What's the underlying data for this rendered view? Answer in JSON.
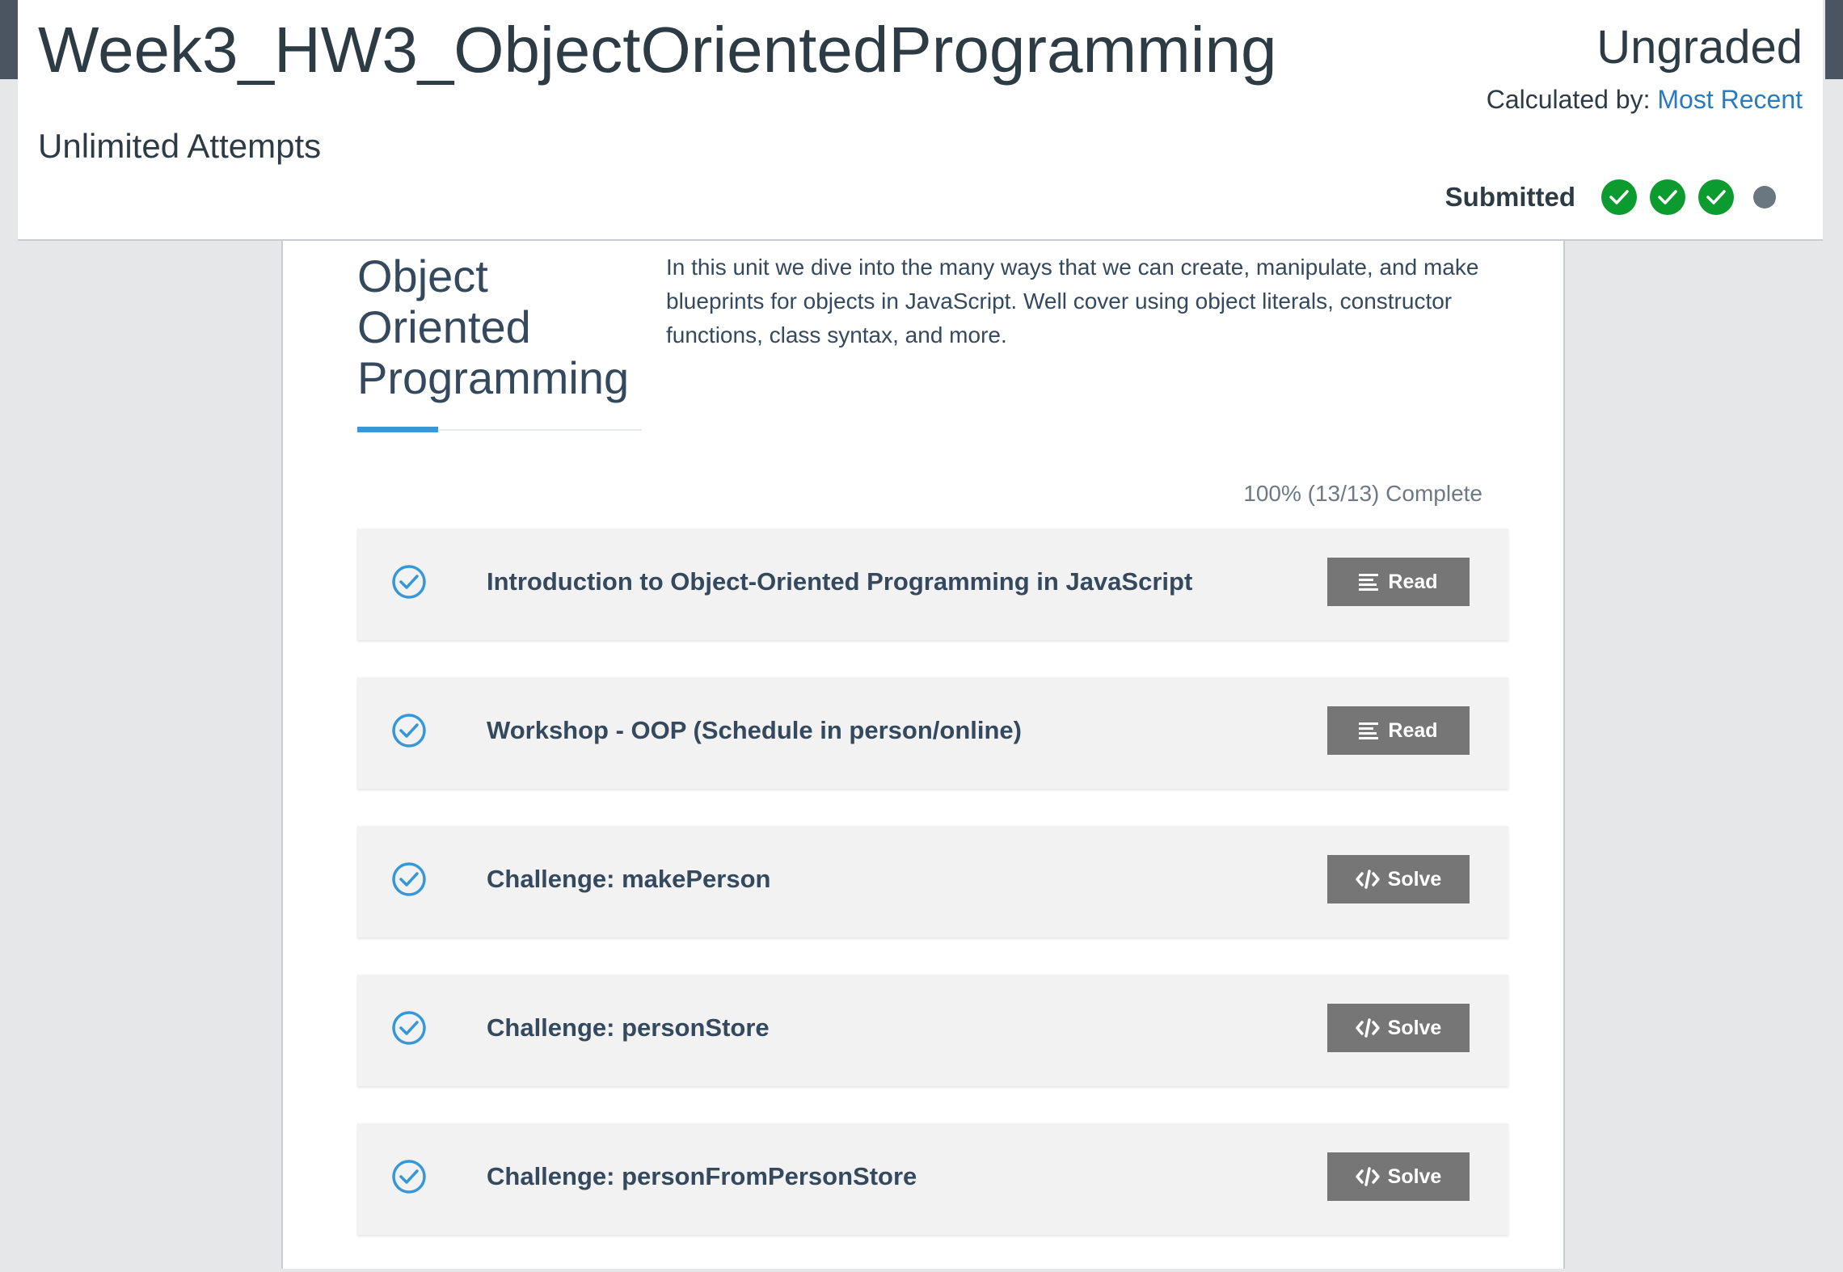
{
  "header": {
    "title": "Week3_HW3_ObjectOrientedProgramming",
    "attempts": "Unlimited Attempts",
    "grade_status": "Ungraded",
    "calculated_by_label": "Calculated by:",
    "calculated_by_value": "Most Recent",
    "submitted_label": "Submitted",
    "attempts_indicators": [
      "check-icon",
      "check-icon",
      "check-icon",
      "dot-icon"
    ]
  },
  "unit": {
    "heading": "Object Oriented Programming",
    "description": "In this unit we dive into the many ways that we can create, manipulate, and make blueprints for objects in JavaScript. Well cover using object literals, constructor functions, class syntax, and more.",
    "progress": "100% (13/13) Complete",
    "progress_fraction": 1.0
  },
  "items": [
    {
      "title": "Introduction to Object-Oriented Programming in JavaScript",
      "button": "Read",
      "button_icon": "list-icon",
      "completed": true
    },
    {
      "title": "Workshop - OOP (Schedule in person/online)",
      "button": "Read",
      "button_icon": "list-icon",
      "completed": true
    },
    {
      "title": "Challenge: makePerson",
      "button": "Solve",
      "button_icon": "code-icon",
      "completed": true
    },
    {
      "title": "Challenge: personStore",
      "button": "Solve",
      "button_icon": "code-icon",
      "completed": true
    },
    {
      "title": "Challenge: personFromPersonStore",
      "button": "Solve",
      "button_icon": "code-icon",
      "completed": true
    }
  ],
  "colors": {
    "accent_blue": "#3498db",
    "link_blue": "#2b7abc",
    "success_green": "#0b9b2f",
    "button_gray": "#767676",
    "text_dark": "#2d3b45"
  }
}
